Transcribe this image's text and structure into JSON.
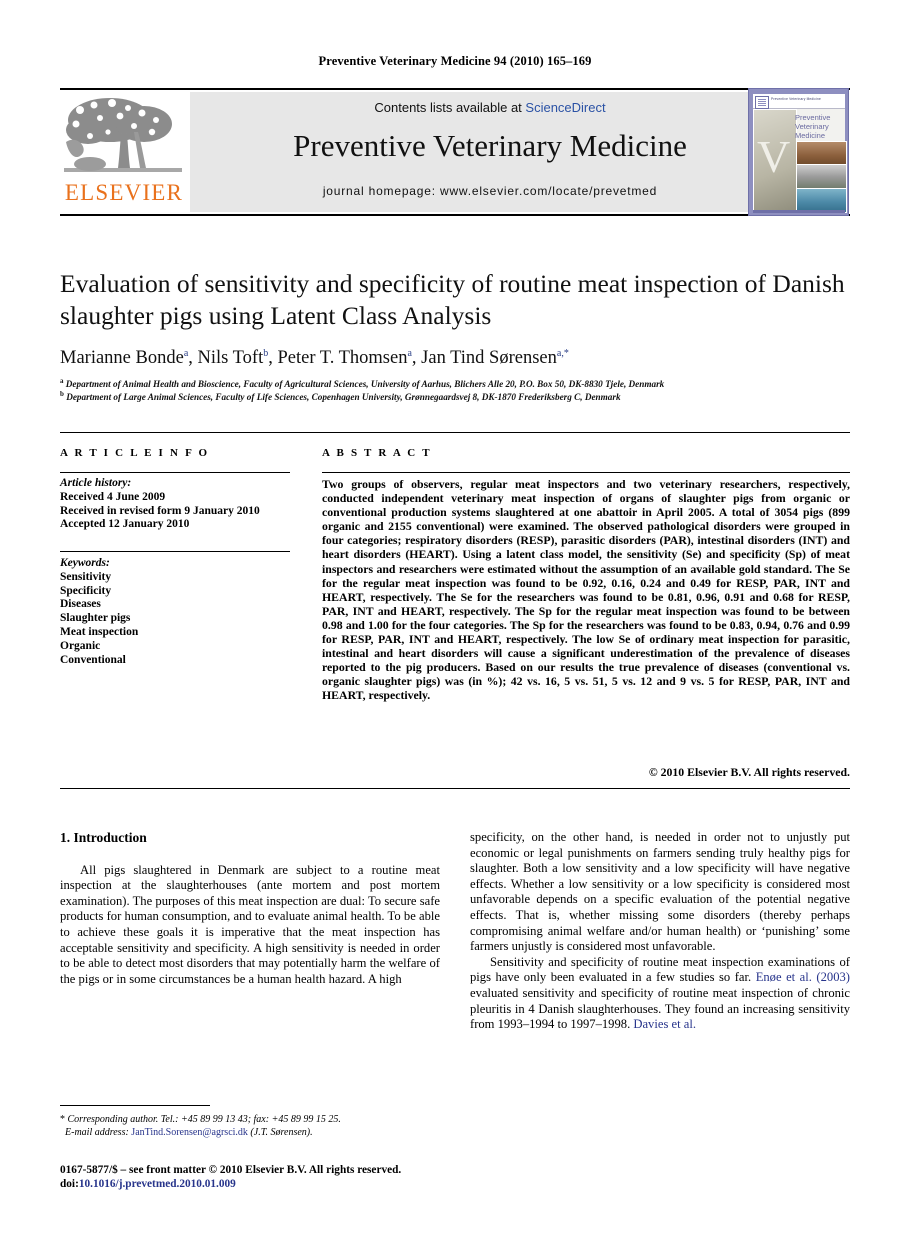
{
  "running_head": "Preventive Veterinary Medicine 94 (2010) 165–169",
  "masthead": {
    "contents_prefix": "Contents lists available at ",
    "contents_link": "ScienceDirect",
    "journal_name": "Preventive Veterinary Medicine",
    "homepage": "journal homepage: www.elsevier.com/locate/prevetmed",
    "publisher_wordmark": "ELSEVIER",
    "publisher_color": "#E9711C",
    "cover": {
      "title": "Preventive Veterinary Medicine",
      "top_bar_text": "Preventive Veterinary Medicine"
    }
  },
  "article": {
    "title": "Evaluation of sensitivity and specificity of routine meat inspection of Danish slaughter pigs using Latent Class Analysis",
    "authors": [
      {
        "name": "Marianne Bonde",
        "marks": "a"
      },
      {
        "name": "Nils Toft",
        "marks": "b"
      },
      {
        "name": "Peter T. Thomsen",
        "marks": "a"
      },
      {
        "name": "Jan Tind Sørensen",
        "marks": "a,*"
      }
    ],
    "affiliations": [
      {
        "mark": "a",
        "text": "Department of Animal Health and Bioscience, Faculty of Agricultural Sciences, University of Aarhus, Blichers Alle 20, P.O. Box 50, DK-8830 Tjele, Denmark"
      },
      {
        "mark": "b",
        "text": "Department of Large Animal Sciences, Faculty of Life Sciences, Copenhagen University, Grønnegaardsvej 8, DK-1870 Frederiksberg C, Denmark"
      }
    ]
  },
  "article_info": {
    "heading": "A R T I C L E  I N F O",
    "history_label": "Article history:",
    "history": [
      "Received 4 June 2009",
      "Received in revised form 9 January 2010",
      "Accepted 12 January 2010"
    ],
    "keywords_label": "Keywords:",
    "keywords": [
      "Sensitivity",
      "Specificity",
      "Diseases",
      "Slaughter pigs",
      "Meat inspection",
      "Organic",
      "Conventional"
    ]
  },
  "abstract": {
    "heading": "A B S T R A C T",
    "text": "Two groups of observers, regular meat inspectors and two veterinary researchers, respectively, conducted independent veterinary meat inspection of organs of slaughter pigs from organic or conventional production systems slaughtered at one abattoir in April 2005. A total of 3054 pigs (899 organic and 2155 conventional) were examined. The observed pathological disorders were grouped in four categories; respiratory disorders (RESP), parasitic disorders (PAR), intestinal disorders (INT) and heart disorders (HEART). Using a latent class model, the sensitivity (Se) and specificity (Sp) of meat inspectors and researchers were estimated without the assumption of an available gold standard. The Se for the regular meat inspection was found to be 0.92, 0.16, 0.24 and 0.49 for RESP, PAR, INT and HEART, respectively. The Se for the researchers was found to be 0.81, 0.96, 0.91 and 0.68 for RESP, PAR, INT and HEART, respectively. The Sp for the regular meat inspection was found to be between 0.98 and 1.00 for the four categories. The Sp for the researchers was found to be 0.83, 0.94, 0.76 and 0.99 for RESP, PAR, INT and HEART, respectively. The low Se of ordinary meat inspection for parasitic, intestinal and heart disorders will cause a significant underestimation of the prevalence of diseases reported to the pig producers. Based on our results the true prevalence of diseases (conventional vs. organic slaughter pigs) was (in %); 42 vs. 16, 5 vs. 51, 5 vs. 12 and 9 vs. 5 for RESP, PAR, INT and HEART, respectively.",
    "copyright": "© 2010 Elsevier B.V. All rights reserved."
  },
  "body": {
    "section_heading": "1. Introduction",
    "left_paragraphs": [
      "All pigs slaughtered in Denmark are subject to a routine meat inspection at the slaughterhouses (ante mortem and post mortem examination). The purposes of this meat inspection are dual: To secure safe products for human consumption, and to evaluate animal health. To be able to achieve these goals it is imperative that the meat inspection has acceptable sensitivity and specificity. A high sensitivity is needed in order to be able to detect most disorders that may potentially harm the welfare of the pigs or in some circumstances be a human health hazard. A high"
    ],
    "right_paragraphs": [
      "specificity, on the other hand, is needed in order not to unjustly put economic or legal punishments on farmers sending truly healthy pigs for slaughter. Both a low sensitivity and a low specificity will have negative effects. Whether a low sensitivity or a low specificity is considered most unfavorable depends on a specific evaluation of the potential negative effects. That is, whether missing some disorders (thereby perhaps compromising animal welfare and/or human health) or ‘punishing’ some farmers unjustly is considered most unfavorable."
    ],
    "right_paragraph_2_parts": {
      "a": "Sensitivity and specificity of routine meat inspection examinations of pigs have only been evaluated in a few studies so far. ",
      "cite1": "Enøe et al. (2003)",
      "b": " evaluated sensitivity and specificity of routine meat inspection of chronic pleuritis in 4 Danish slaughterhouses. They found an increasing sensitivity from 1993–1994 to 1997–1998. ",
      "cite2": "Davies et al."
    }
  },
  "footer": {
    "corresponding_marker": "*",
    "corresponding_text": "Corresponding author. Tel.: +45 89 99 13 43; fax: +45 89 99 15 25.",
    "email_label": "E-mail address:",
    "email": "JanTind.Sorensen@agrsci.dk",
    "email_suffix": "(J.T. Sørensen).",
    "issn_line": "0167-5877/$ – see front matter © 2010 Elsevier B.V. All rights reserved.",
    "doi_label": "doi:",
    "doi": "10.1016/j.prevetmed.2010.01.009"
  }
}
